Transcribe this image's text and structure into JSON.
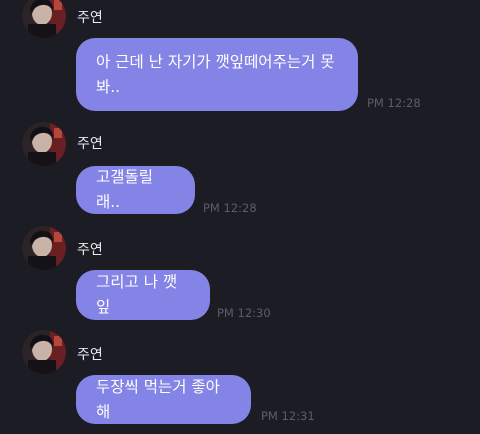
{
  "chat": {
    "messages": [
      {
        "sender": "주연",
        "text": "아 근데 난 자기가 깻잎떼어주는거 못 봐..",
        "time": "PM 12:28"
      },
      {
        "sender": "주연",
        "text": "고갤돌릴래..",
        "time": "PM 12:28"
      },
      {
        "sender": "주연",
        "text": "그리고 나 깻잎",
        "time": "PM 12:30"
      },
      {
        "sender": "주연",
        "text": "두장씩 먹는거 좋아해",
        "time": "PM 12:31"
      }
    ]
  },
  "colors": {
    "background": "#1c1c24",
    "bubble": "#8483e6",
    "sender_text": "#e8e8ee",
    "timestamp": "#5d5d6a"
  }
}
